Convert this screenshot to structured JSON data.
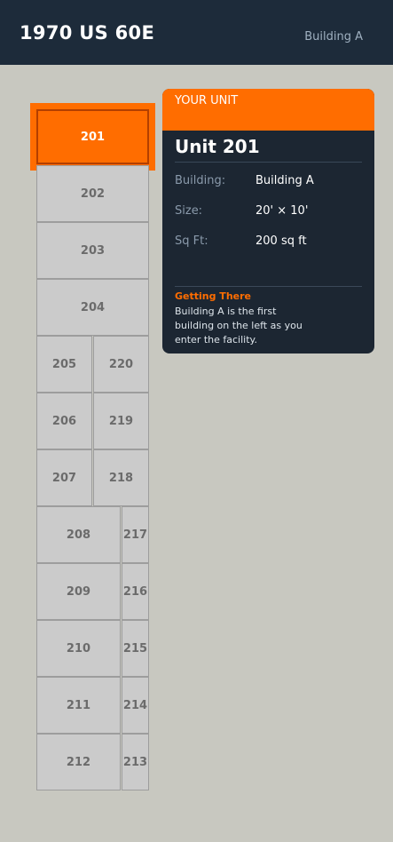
{
  "header": {
    "title": "1970 US 60E",
    "building": "Building A"
  },
  "units": {
    "u201": "201",
    "u202": "202",
    "u203": "203",
    "u204": "204",
    "u205": "205",
    "u206": "206",
    "u207": "207",
    "u208": "208",
    "u209": "209",
    "u210": "210",
    "u211": "211",
    "u212": "212",
    "u213": "213",
    "u214": "214",
    "u215": "215",
    "u216": "216",
    "u217": "217",
    "u218": "218",
    "u219": "219",
    "u220": "220"
  },
  "selected_unit": "201",
  "card": {
    "caption": "YOUR UNIT",
    "title": "Unit 201",
    "building_label": "Building:",
    "building_value": "Building A",
    "size_label": "Size:",
    "size_value": "20' × 10'",
    "sqft_label": "Sq Ft:",
    "sqft_value": "200 sq ft",
    "getting_there_heading": "Getting There",
    "getting_there_text": "Building A is the first building on the left as you enter the facility."
  },
  "colors": {
    "header_bg": "#1d2b3a",
    "accent": "#ff6d00",
    "card_bg": "#1c2632",
    "page_bg": "#c8c8c0",
    "unit_bg": "#cbcbcb"
  }
}
